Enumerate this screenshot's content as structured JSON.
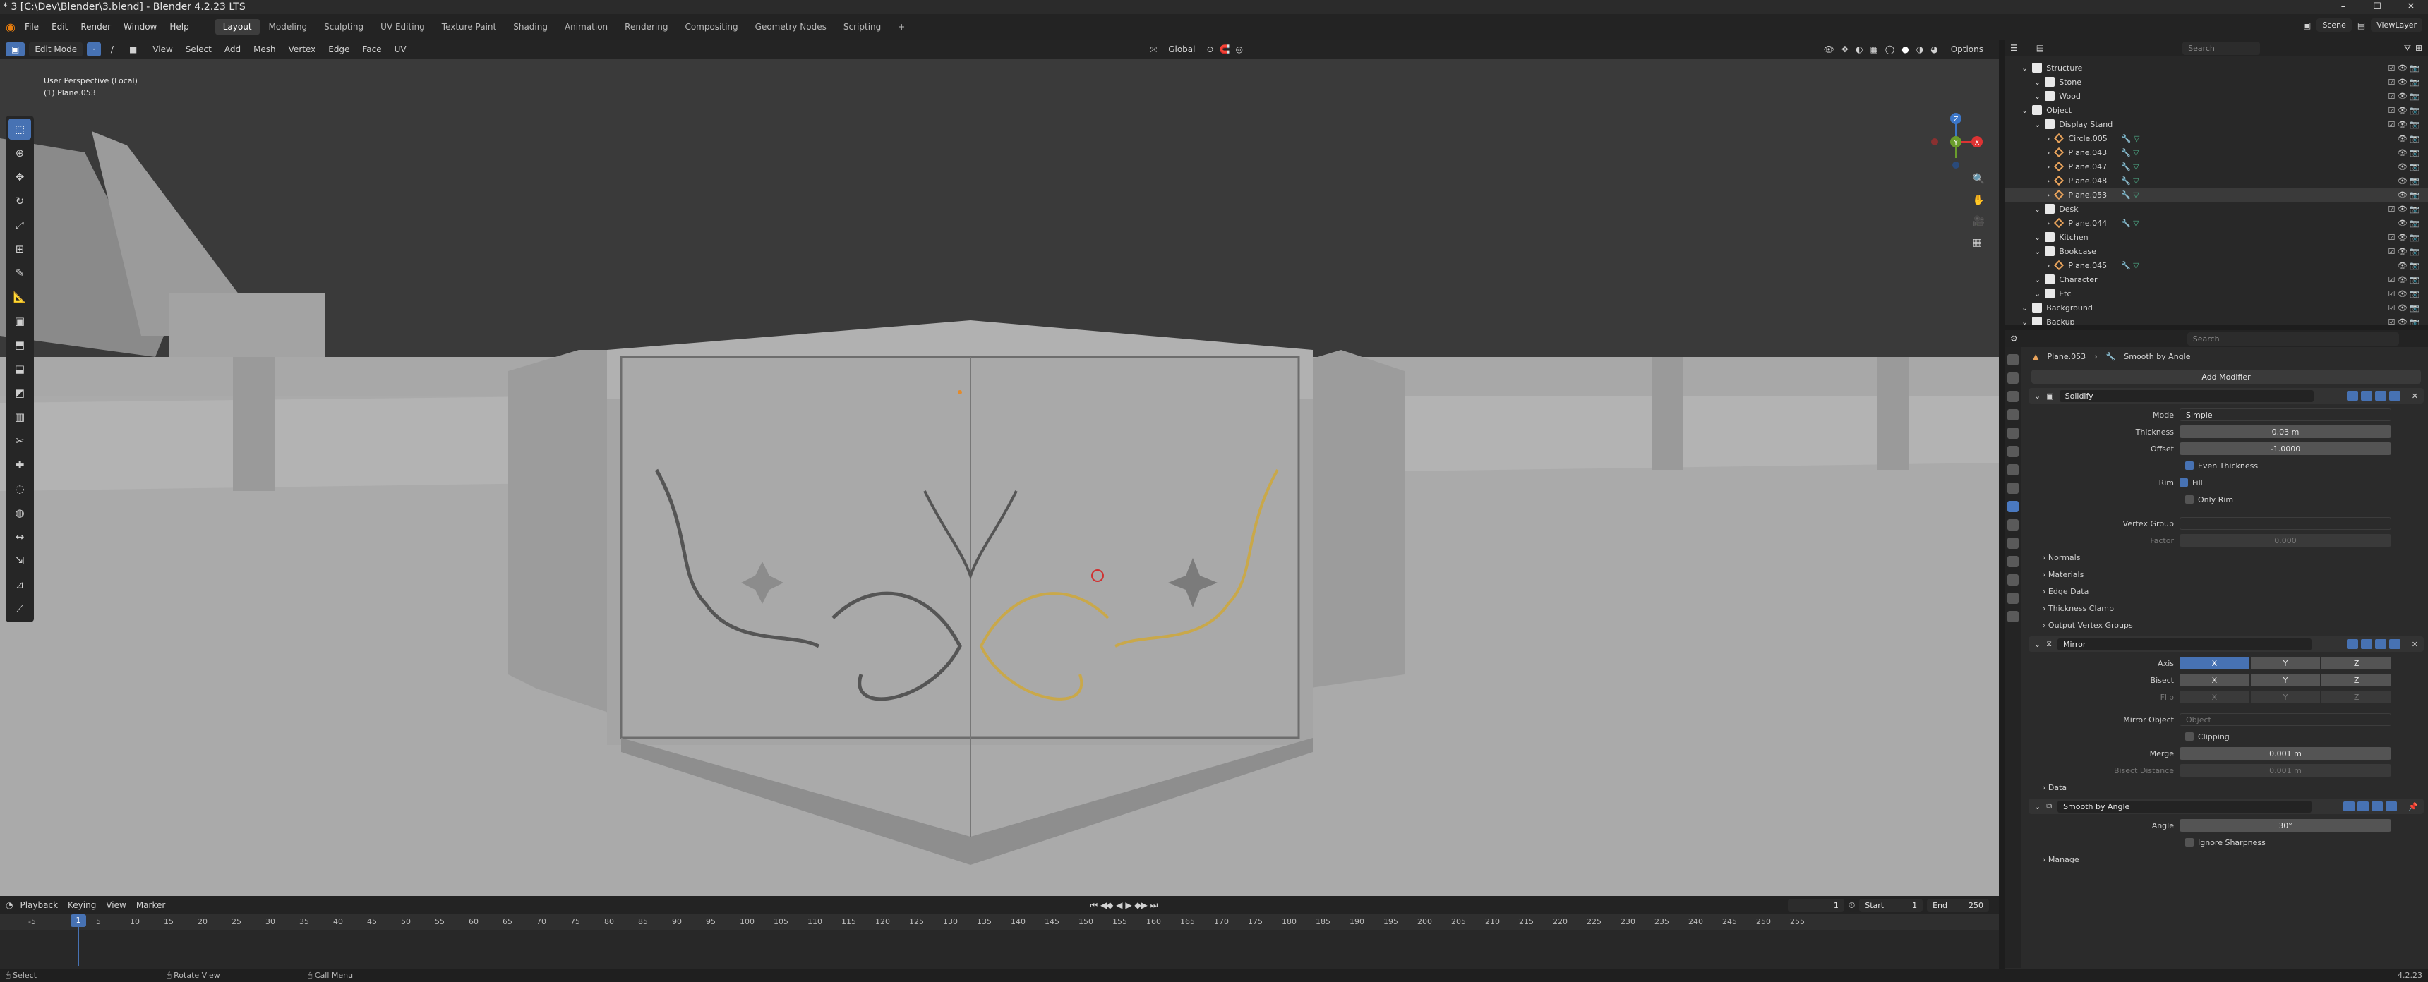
{
  "titlebar": {
    "title": "* 3 [C:\\Dev\\Blender\\3.blend] - Blender 4.2.23 LTS",
    "minimize": "–",
    "maximize": "☐",
    "close": "✕"
  },
  "menubar": {
    "items": [
      "File",
      "Edit",
      "Render",
      "Window",
      "Help"
    ],
    "workspaces": [
      "Layout",
      "Modeling",
      "Sculpting",
      "UV Editing",
      "Texture Paint",
      "Shading",
      "Animation",
      "Rendering",
      "Compositing",
      "Geometry Nodes",
      "Scripting",
      "+"
    ],
    "active_workspace": "Layout",
    "scene": "Scene",
    "view_layer": "ViewLayer"
  },
  "viewport": {
    "mode": "Edit Mode",
    "menus": [
      "View",
      "Select",
      "Add",
      "Mesh",
      "Vertex",
      "Edge",
      "Face",
      "UV"
    ],
    "orientation": "Global",
    "options": "Options",
    "view_name": "User Perspective (Local)",
    "object_name": "(1) Plane.053",
    "gizmo": {
      "x": "X",
      "y": "Y",
      "z": "Z"
    },
    "tools": [
      "select-box",
      "cursor",
      "move",
      "rotate",
      "scale",
      "transform",
      "annotate",
      "measure",
      "add-cube",
      "extrude",
      "inset",
      "bevel",
      "loop-cut",
      "knife",
      "poly-build",
      "spin",
      "smooth",
      "edge-slide",
      "shrink",
      "shear",
      "rip"
    ]
  },
  "timeline": {
    "menus": [
      "Playback",
      "Keying",
      "View",
      "Marker"
    ],
    "current_frame": "1",
    "start_label": "Start",
    "start": "1",
    "end_label": "End",
    "end": "250",
    "ruler": [
      "-5",
      "1",
      "5",
      "10",
      "15",
      "20",
      "25",
      "30",
      "35",
      "40",
      "45",
      "50",
      "55",
      "60",
      "65",
      "70",
      "75",
      "80",
      "85",
      "90",
      "95",
      "100",
      "105",
      "110",
      "115",
      "120",
      "125",
      "130",
      "135",
      "140",
      "145",
      "150",
      "155",
      "160",
      "165",
      "170",
      "175",
      "180",
      "185",
      "190",
      "195",
      "200",
      "205",
      "210",
      "215",
      "220",
      "225",
      "230",
      "235",
      "240",
      "245",
      "250",
      "255"
    ]
  },
  "statusbar": {
    "select": "Select",
    "rotate": "Rotate View",
    "menu": "Call Menu",
    "version": "4.2.23"
  },
  "outliner": {
    "search_placeholder": "Search",
    "rows": [
      {
        "label": "Structure",
        "indent": 1,
        "kind": "collection"
      },
      {
        "label": "Stone",
        "indent": 2,
        "kind": "collection"
      },
      {
        "label": "Wood",
        "indent": 2,
        "kind": "collection"
      },
      {
        "label": "Object",
        "indent": 1,
        "kind": "collection"
      },
      {
        "label": "Display Stand",
        "indent": 2,
        "kind": "collection"
      },
      {
        "label": "Circle.005",
        "indent": 3,
        "kind": "mesh"
      },
      {
        "label": "Plane.043",
        "indent": 3,
        "kind": "mesh"
      },
      {
        "label": "Plane.047",
        "indent": 3,
        "kind": "mesh"
      },
      {
        "label": "Plane.048",
        "indent": 3,
        "kind": "mesh"
      },
      {
        "label": "Plane.053",
        "indent": 3,
        "kind": "mesh",
        "selected": true
      },
      {
        "label": "Desk",
        "indent": 2,
        "kind": "collection"
      },
      {
        "label": "Plane.044",
        "indent": 3,
        "kind": "mesh"
      },
      {
        "label": "Kitchen",
        "indent": 2,
        "kind": "collection"
      },
      {
        "label": "Bookcase",
        "indent": 2,
        "kind": "collection"
      },
      {
        "label": "Plane.045",
        "indent": 3,
        "kind": "mesh"
      },
      {
        "label": "Character",
        "indent": 2,
        "kind": "collection"
      },
      {
        "label": "Etc",
        "indent": 2,
        "kind": "collection"
      },
      {
        "label": "Background",
        "indent": 1,
        "kind": "collection"
      },
      {
        "label": "Backup",
        "indent": 1,
        "kind": "collection"
      }
    ]
  },
  "properties": {
    "search_placeholder": "Search",
    "breadcrumb": [
      "Plane.053",
      "Smooth by Angle"
    ],
    "add_modifier": "Add Modifier",
    "solidify": {
      "name": "Solidify",
      "mode_label": "Mode",
      "mode": "Simple",
      "thickness_label": "Thickness",
      "thickness": "0.03 m",
      "offset_label": "Offset",
      "offset": "-1.0000",
      "even_thickness": "Even Thickness",
      "rim_label": "Rim",
      "fill": "Fill",
      "only_rim": "Only Rim",
      "vertex_group_label": "Vertex Group",
      "factor_label": "Factor",
      "factor": "0.000",
      "panels": [
        "Normals",
        "Materials",
        "Edge Data",
        "Thickness Clamp",
        "Output Vertex Groups"
      ]
    },
    "mirror": {
      "name": "Mirror",
      "axis_label": "Axis",
      "bisect_label": "Bisect",
      "flip_label": "Flip",
      "axes": [
        "X",
        "Y",
        "Z"
      ],
      "mirror_object_label": "Mirror Object",
      "mirror_object_placeholder": "Object",
      "clipping": "Clipping",
      "merge_label": "Merge",
      "merge": "0.001 m",
      "bisect_distance_label": "Bisect Distance",
      "bisect_distance": "0.001 m",
      "data_panel": "Data"
    },
    "smooth": {
      "name": "Smooth by Angle",
      "angle_label": "Angle",
      "angle": "30°",
      "ignore_sharpness": "Ignore Sharpness",
      "manage_panel": "Manage"
    }
  }
}
